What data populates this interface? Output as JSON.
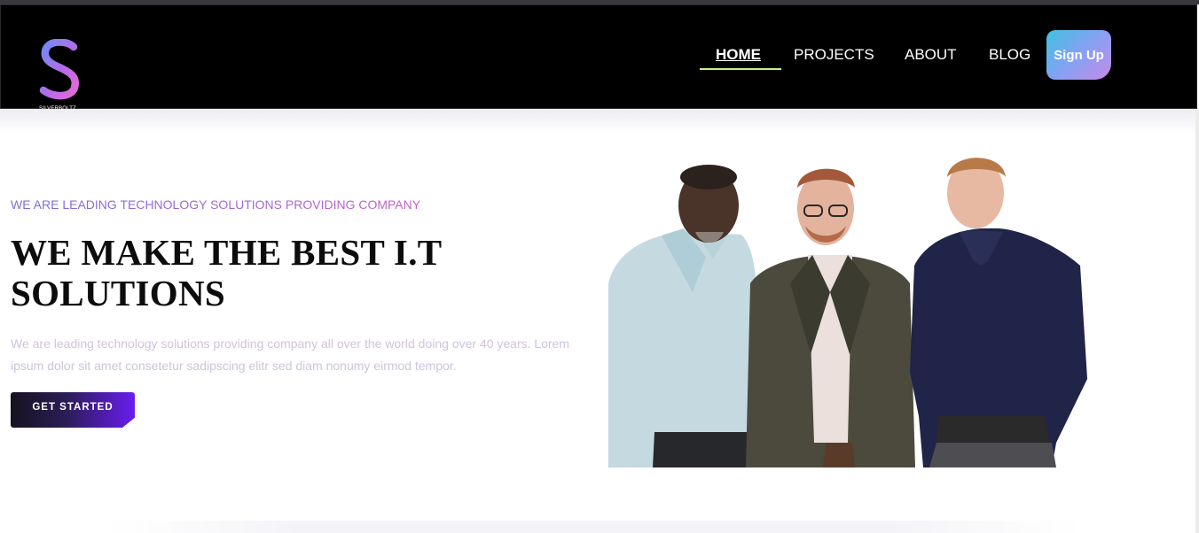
{
  "brand": {
    "name": "SILVERBOLTZ",
    "mark": "S"
  },
  "nav": {
    "items": [
      {
        "label": "HOME",
        "active": true
      },
      {
        "label": "PROJECTS",
        "active": false
      },
      {
        "label": "ABOUT",
        "active": false
      },
      {
        "label": "BLOG",
        "active": false
      }
    ],
    "signup_label": "Sign Up"
  },
  "hero": {
    "tagline": "WE ARE LEADING TECHNOLOGY SOLUTIONS PROVIDING COMPANY",
    "headline": "WE MAKE THE BEST I.T SOLUTIONS",
    "description": "We are leading technology solutions providing company all over the world doing over 40 years. Lorem ipsum dolor sit amet consetetur sadipscing elitr sed diam nonumy eirmod tempor.",
    "cta_label": "GET STARTED"
  },
  "colors": {
    "navbar_bg": "#000000",
    "nav_active_underline": "#c9f07e",
    "signup_gradient": [
      "#3ec2e0",
      "#c58ae8"
    ],
    "tagline_gradient": [
      "#7b6fd6",
      "#c35fc9"
    ],
    "cta_gradient": [
      "#16131f",
      "#6a1df0"
    ],
    "logo_gradient": [
      "#6f8cf5",
      "#e66ad8"
    ]
  }
}
